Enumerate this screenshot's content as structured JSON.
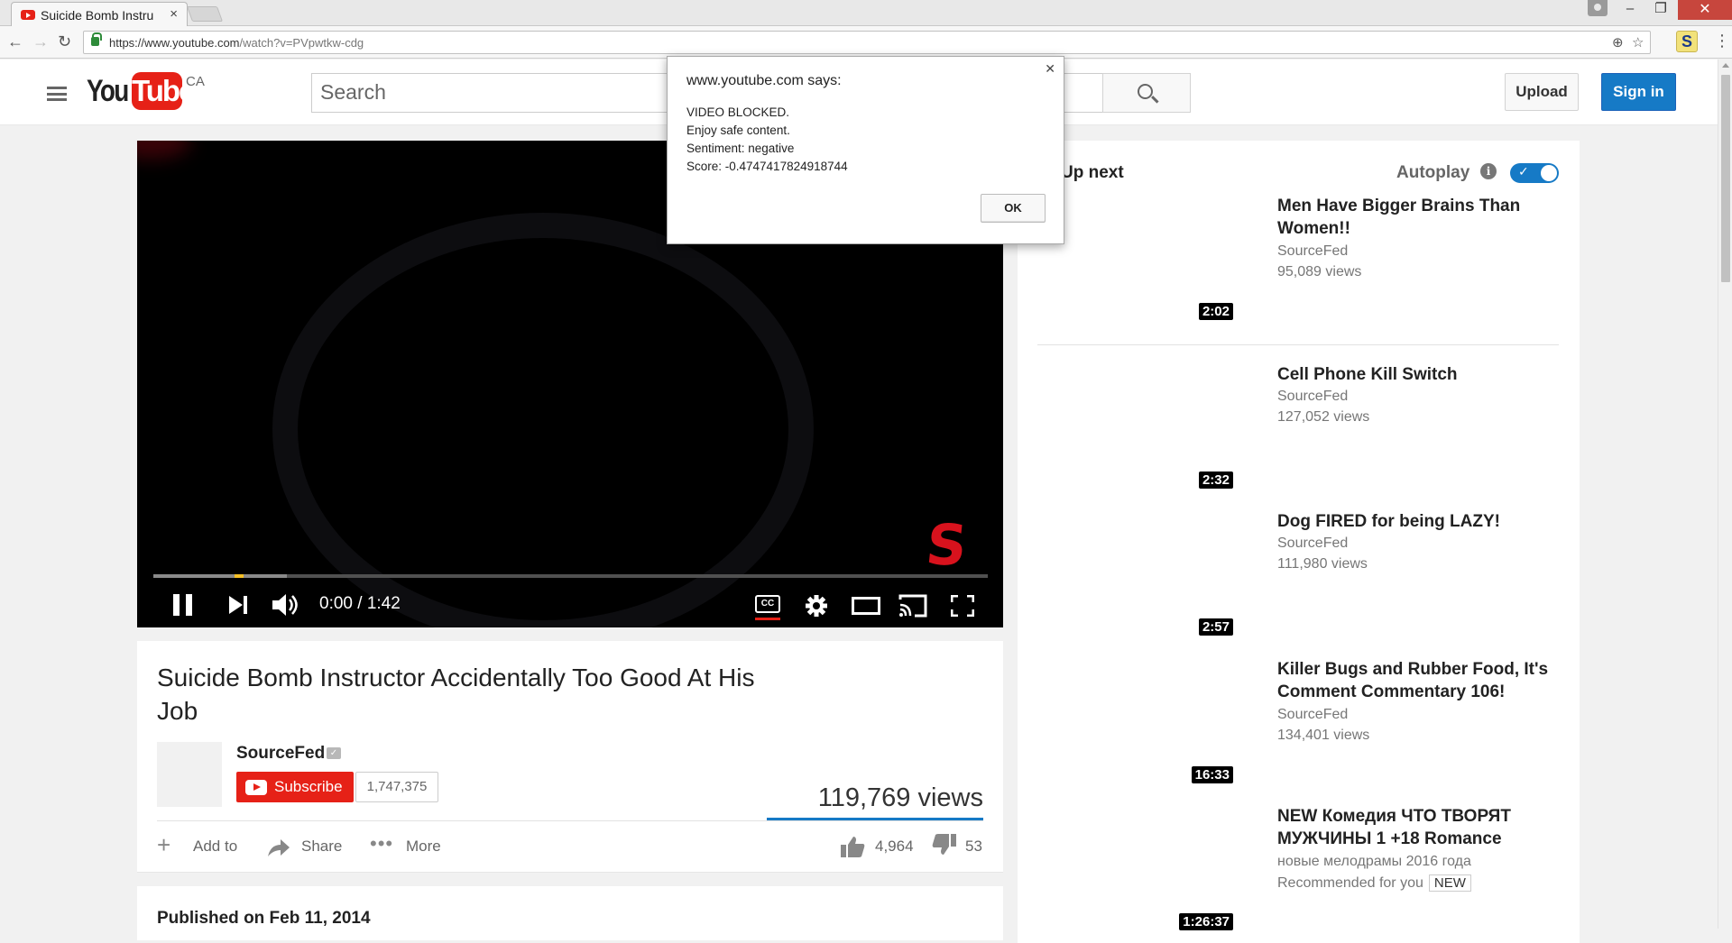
{
  "browser": {
    "tab_title": "Suicide Bomb Instru",
    "url_host": "https://www.youtube.com",
    "url_path": "/watch?v=PVpwtkw-cdg",
    "extension_label": "S"
  },
  "header": {
    "logo_you": "You",
    "logo_tube": "Tube",
    "region": "CA",
    "search_placeholder": "Search",
    "upload_label": "Upload",
    "signin_label": "Sign in"
  },
  "player": {
    "time": "0:00 / 1:42",
    "cc_label": "CC",
    "watermark": "S",
    "played_fraction": 0.0,
    "buffered_fraction": 0.16
  },
  "video": {
    "title": "Suicide Bomb Instructor Accidentally Too Good At His Job",
    "channel": "SourceFed",
    "subscribe_label": "Subscribe",
    "subscriber_count": "1,747,375",
    "views": "119,769 views",
    "actions": {
      "add_to": "Add to",
      "share": "Share",
      "more": "More"
    },
    "likes": "4,964",
    "dislikes": "53",
    "published": "Published on Feb 11, 2014"
  },
  "sidebar": {
    "up_next": "Up next",
    "autoplay_label": "Autoplay",
    "autoplay_on": true,
    "videos": [
      {
        "title": "Men Have Bigger Brains Than Women!!",
        "channel": "SourceFed",
        "meta": "95,089 views",
        "duration": "2:02"
      },
      {
        "title": "Cell Phone Kill Switch",
        "channel": "SourceFed",
        "meta": "127,052 views",
        "duration": "2:32"
      },
      {
        "title": "Dog FIRED for being LAZY!",
        "channel": "SourceFed",
        "meta": "111,980 views",
        "duration": "2:57"
      },
      {
        "title": "Killer Bugs and Rubber Food, It's Comment Commentary 106!",
        "channel": "SourceFed",
        "meta": "134,401 views",
        "duration": "16:33"
      },
      {
        "title": "NEW Комедия ЧТО ТВОРЯТ МУЖЧИНЫ 1 +18 Romance",
        "channel": "новые мелодрамы 2016 года",
        "meta": "Recommended for you",
        "badge": "NEW",
        "duration": "1:26:37"
      }
    ]
  },
  "dialog": {
    "title": "www.youtube.com says:",
    "message": "VIDEO BLOCKED.\nEnjoy safe content.\nSentiment: negative\nScore: -0.4747417824918744",
    "ok_label": "OK"
  },
  "colors": {
    "brand_red": "#e62117",
    "accent_blue": "#167ac6"
  }
}
